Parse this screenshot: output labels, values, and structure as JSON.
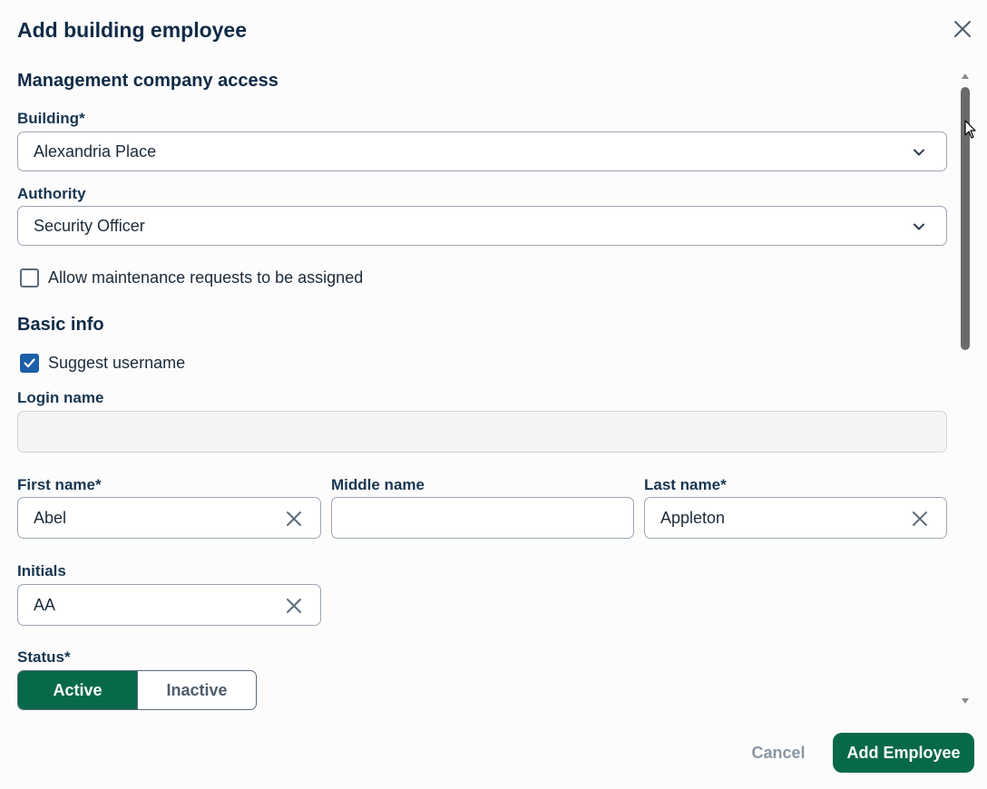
{
  "dialog": {
    "title": "Add building employee"
  },
  "management": {
    "section_title": "Management company access",
    "building_label": "Building*",
    "building_value": "Alexandria Place",
    "authority_label": "Authority",
    "authority_value": "Security Officer",
    "maintenance_checkbox_label": "Allow maintenance requests to be assigned",
    "maintenance_checked": false
  },
  "basic_info": {
    "section_title": "Basic info",
    "suggest_username_label": "Suggest username",
    "suggest_username_checked": true,
    "login_name_label": "Login name",
    "login_name_value": "",
    "first_name_label": "First name*",
    "first_name_value": "Abel",
    "middle_name_label": "Middle name",
    "middle_name_value": "",
    "last_name_label": "Last name*",
    "last_name_value": "Appleton",
    "initials_label": "Initials",
    "initials_value": "AA",
    "status_label": "Status*",
    "status_options": [
      "Active",
      "Inactive"
    ],
    "status_selected": "Active"
  },
  "footer": {
    "cancel_label": "Cancel",
    "submit_label": "Add Employee"
  },
  "colors": {
    "primary": "#07684a",
    "checkbox_checked": "#1c5ea8",
    "heading": "#0f2b46"
  },
  "icons": {
    "close": "close-icon",
    "dropdown": "chevron-down-icon",
    "clear": "clear-icon",
    "check": "checkmark-icon"
  }
}
